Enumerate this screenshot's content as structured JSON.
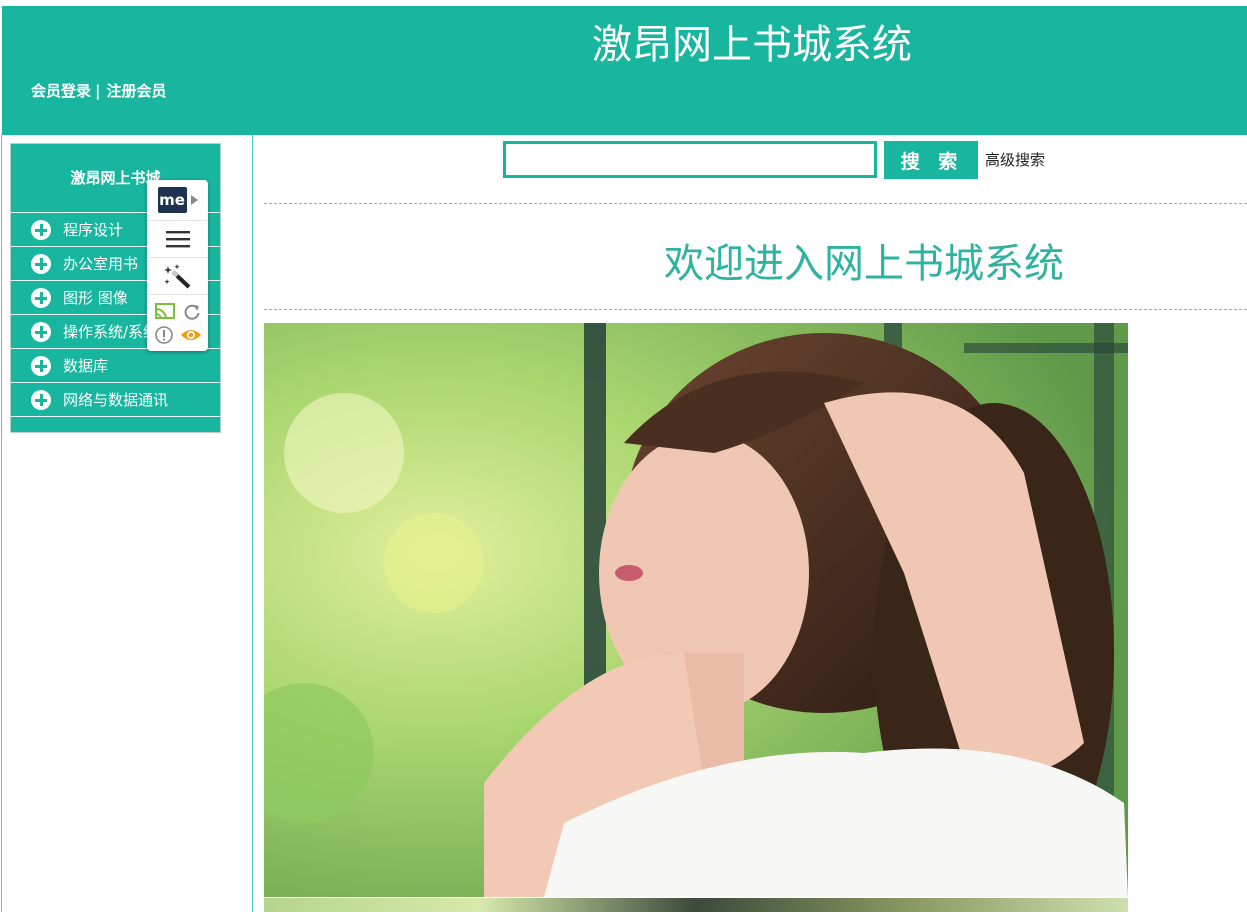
{
  "header": {
    "site_title": "激昂网上书城系统",
    "login_link": "会员登录",
    "separator": "|",
    "register_link": "注册会员"
  },
  "sidebar": {
    "title": "激昂网上书城",
    "categories": [
      {
        "label": "程序设计"
      },
      {
        "label": "办公室用书"
      },
      {
        "label": "图形 图像"
      },
      {
        "label": "操作系统/系统"
      },
      {
        "label": "数据库"
      },
      {
        "label": "网络与数据通讯"
      }
    ]
  },
  "extension_popup": {
    "logo_text": "me"
  },
  "search": {
    "input_value": "",
    "button_label": "搜 索",
    "advanced_label": "高级搜索"
  },
  "main": {
    "welcome": "欢迎进入网上书城系统"
  },
  "colors": {
    "accent": "#18b69e",
    "welcome_text": "#2fb2a0",
    "divider": "#4fc5d8"
  }
}
